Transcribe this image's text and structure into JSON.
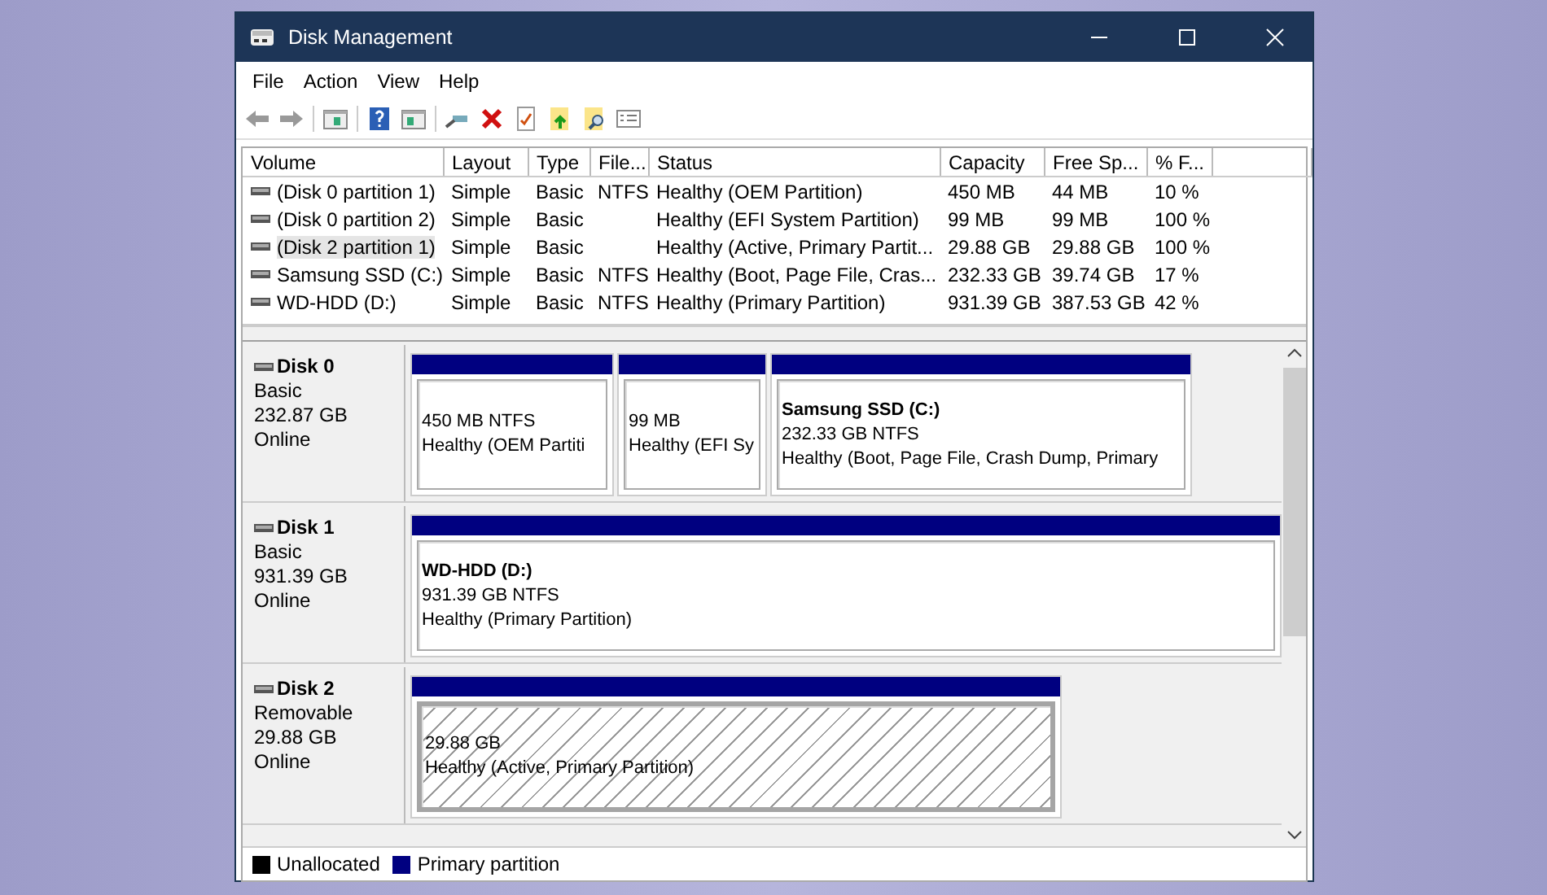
{
  "window": {
    "title": "Disk Management"
  },
  "menu": [
    "File",
    "Action",
    "View",
    "Help"
  ],
  "volume_list": {
    "columns": [
      "Volume",
      "Layout",
      "Type",
      "File...",
      "Status",
      "Capacity",
      "Free Sp...",
      "% F..."
    ],
    "rows": [
      {
        "cells": [
          "(Disk 0 partition 1)",
          "Simple",
          "Basic",
          "NTFS",
          "Healthy (OEM Partition)",
          "450 MB",
          "44 MB",
          "10 %"
        ],
        "selected": false
      },
      {
        "cells": [
          "(Disk 0 partition 2)",
          "Simple",
          "Basic",
          "",
          "Healthy (EFI System Partition)",
          "99 MB",
          "99 MB",
          "100 %"
        ],
        "selected": false
      },
      {
        "cells": [
          "(Disk 2 partition 1)",
          "Simple",
          "Basic",
          "",
          "Healthy (Active, Primary Partit...",
          "29.88 GB",
          "29.88 GB",
          "100 %"
        ],
        "selected": true
      },
      {
        "cells": [
          "Samsung SSD (C:)",
          "Simple",
          "Basic",
          "NTFS",
          "Healthy (Boot, Page File, Cras...",
          "232.33 GB",
          "39.74 GB",
          "17 %"
        ],
        "selected": false
      },
      {
        "cells": [
          "WD-HDD (D:)",
          "Simple",
          "Basic",
          "NTFS",
          "Healthy (Primary Partition)",
          "931.39 GB",
          "387.53 GB",
          "42 %"
        ],
        "selected": false
      }
    ]
  },
  "disks": [
    {
      "name": "Disk 0",
      "type": "Basic",
      "size": "232.87 GB",
      "status": "Online",
      "partitions": [
        {
          "size": "450 MB NTFS",
          "status": "Healthy (OEM Partiti",
          "selected": false
        },
        {
          "size": "99 MB",
          "status": "Healthy (EFI Sy",
          "selected": false
        },
        {
          "label": "Samsung SSD  (C:)",
          "size": "232.33 GB NTFS",
          "status": "Healthy (Boot, Page File, Crash Dump, Primary",
          "selected": false
        }
      ]
    },
    {
      "name": "Disk 1",
      "type": "Basic",
      "size": "931.39 GB",
      "status": "Online",
      "partitions": [
        {
          "label": "WD-HDD  (D:)",
          "size": "931.39 GB NTFS",
          "status": "Healthy (Primary Partition)",
          "selected": false
        }
      ]
    },
    {
      "name": "Disk 2",
      "type": "Removable",
      "size": "29.88 GB",
      "status": "Online",
      "partitions": [
        {
          "size": "29.88 GB",
          "status": "Healthy (Active, Primary Partition)",
          "selected": true
        }
      ]
    }
  ],
  "legend": [
    {
      "label": "Unallocated",
      "color": "#000000"
    },
    {
      "label": "Primary partition",
      "color": "#000080"
    }
  ]
}
